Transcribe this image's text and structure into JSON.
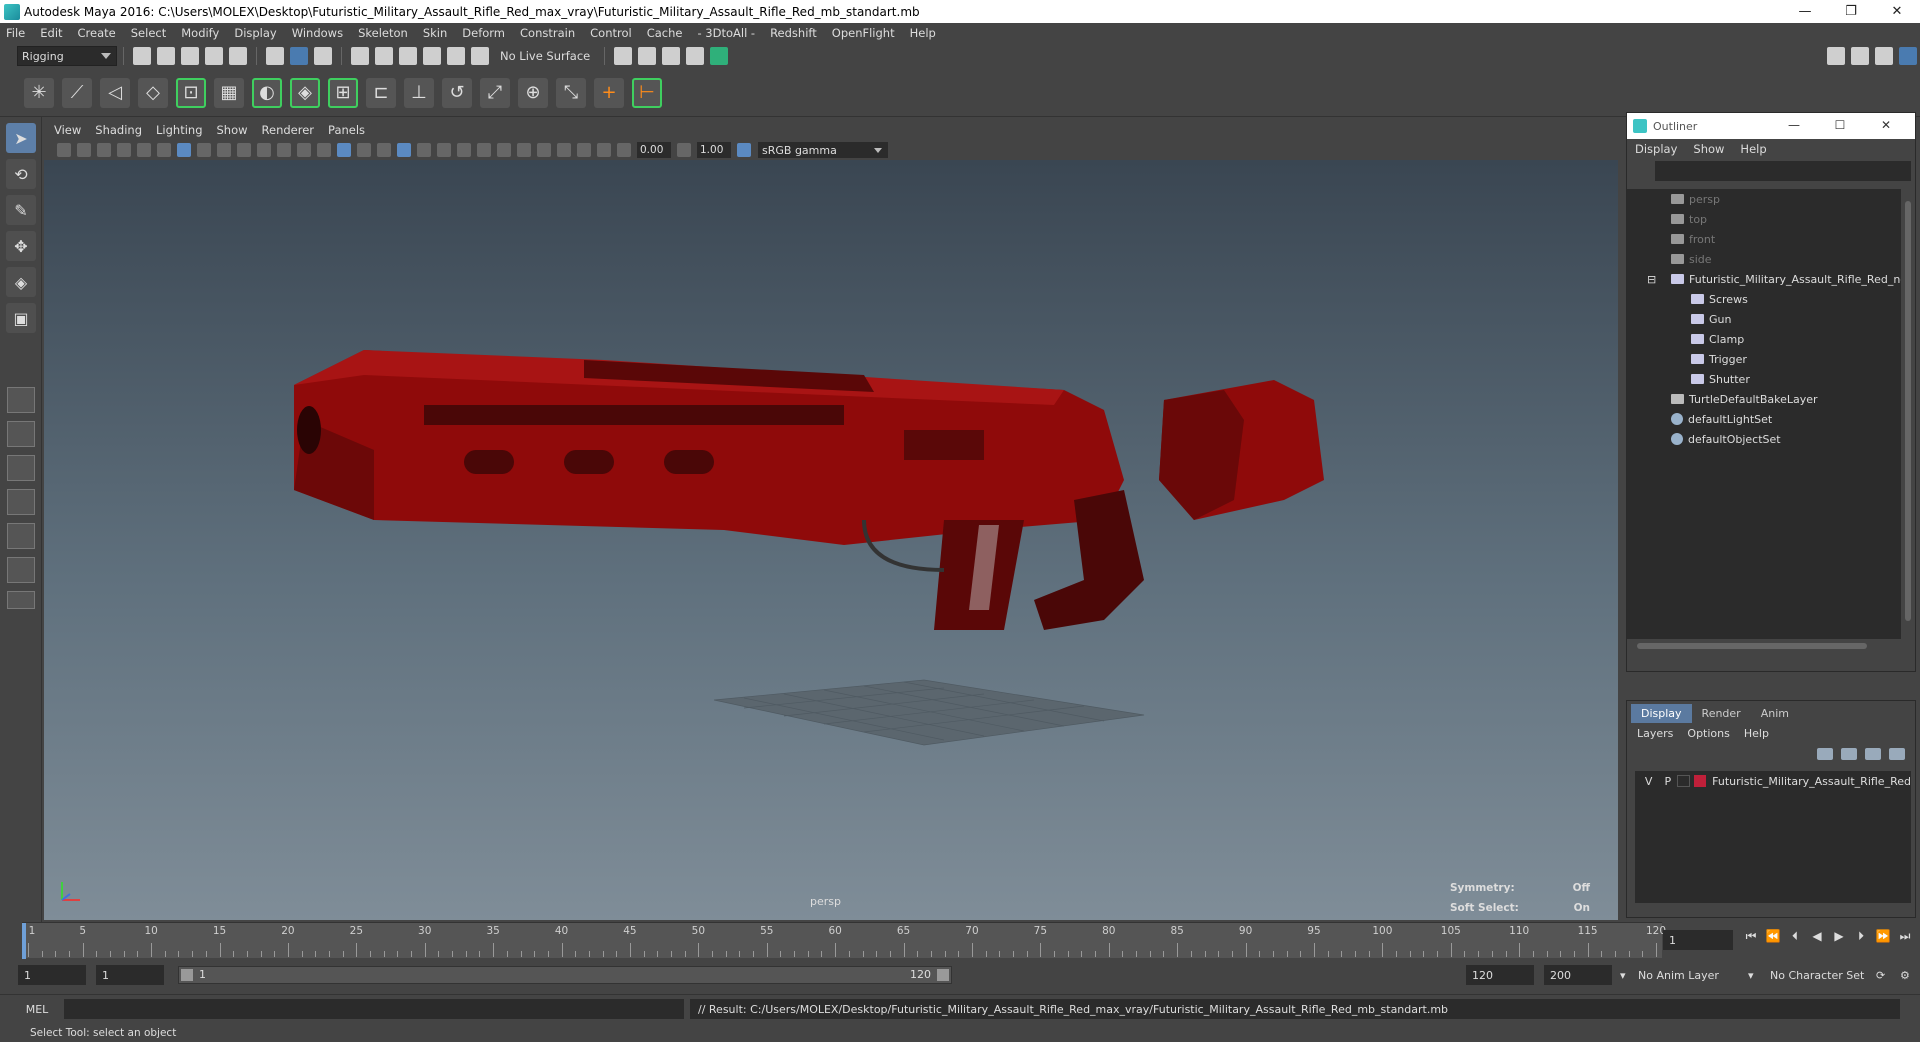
{
  "window": {
    "title": "Autodesk Maya 2016: C:\\Users\\MOLEX\\Desktop\\Futuristic_Military_Assault_Rifle_Red_max_vray\\Futuristic_Military_Assault_Rifle_Red_mb_standart.mb",
    "minimize": "—",
    "restore": "❐",
    "close": "✕"
  },
  "menubar": [
    "File",
    "Edit",
    "Create",
    "Select",
    "Modify",
    "Display",
    "Windows",
    "Skeleton",
    "Skin",
    "Deform",
    "Constrain",
    "Control",
    "Cache",
    "- 3DtoAll -",
    "Redshift",
    "OpenFlight",
    "Help"
  ],
  "shelf": {
    "mode": "Rigging",
    "live_surface": "No Live Surface"
  },
  "viewport": {
    "menu": [
      "View",
      "Shading",
      "Lighting",
      "Show",
      "Renderer",
      "Panels"
    ],
    "exposure": "0.00",
    "gamma_value": "1.00",
    "color_space": "sRGB gamma",
    "camera": "persp",
    "hud": {
      "symmetry_label": "Symmetry:",
      "symmetry_value": "Off",
      "soft_select_label": "Soft Select:",
      "soft_select_value": "On"
    },
    "colors": {
      "rifle": "#8f0a0a",
      "rifle_dark": "#4a0707",
      "background_top": "#3a4652",
      "background_bottom": "#7f8d98"
    }
  },
  "outliner": {
    "title": "Outliner",
    "menu": [
      "Display",
      "Show",
      "Help"
    ],
    "items": [
      {
        "label": "persp",
        "type": "camera",
        "dim": true
      },
      {
        "label": "top",
        "type": "camera",
        "dim": true
      },
      {
        "label": "front",
        "type": "camera",
        "dim": true
      },
      {
        "label": "side",
        "type": "camera",
        "dim": true
      },
      {
        "label": "Futuristic_Military_Assault_Rifle_Red_ncl",
        "type": "group-root",
        "dim": false
      },
      {
        "label": "Screws",
        "type": "group-child",
        "dim": false
      },
      {
        "label": "Gun",
        "type": "group-child",
        "dim": false
      },
      {
        "label": "Clamp",
        "type": "group-child",
        "dim": false
      },
      {
        "label": "Trigger",
        "type": "group-child",
        "dim": false
      },
      {
        "label": "Shutter",
        "type": "group-child",
        "dim": false
      },
      {
        "label": "TurtleDefaultBakeLayer",
        "type": "node",
        "dim": false
      },
      {
        "label": "defaultLightSet",
        "type": "set",
        "dim": false
      },
      {
        "label": "defaultObjectSet",
        "type": "set",
        "dim": false
      }
    ]
  },
  "layer_editor": {
    "tabs": [
      "Display",
      "Render",
      "Anim"
    ],
    "active_tab": "Display",
    "menu": [
      "Layers",
      "Options",
      "Help"
    ],
    "layers": [
      {
        "v": "V",
        "p": "P",
        "color": "#c0203a",
        "name": "Futuristic_Military_Assault_Rifle_Red"
      }
    ]
  },
  "timeline": {
    "labels": [
      "1",
      "5",
      "10",
      "15",
      "20",
      "25",
      "30",
      "35",
      "40",
      "45",
      "50",
      "55",
      "60",
      "65",
      "70",
      "75",
      "80",
      "85",
      "90",
      "95",
      "100",
      "105",
      "110",
      "115",
      "120"
    ],
    "current_frame": "1"
  },
  "range": {
    "start": "1",
    "playback_start": "1",
    "slider_start": "1",
    "slider_end": "120",
    "playback_end": "120",
    "end": "200",
    "anim_layer": "No Anim Layer",
    "character_set": "No Character Set"
  },
  "command_line": {
    "language": "MEL",
    "result": "// Result: C:/Users/MOLEX/Desktop/Futuristic_Military_Assault_Rifle_Red_max_vray/Futuristic_Military_Assault_Rifle_Red_mb_standart.mb"
  },
  "help_line": "Select Tool: select an object"
}
